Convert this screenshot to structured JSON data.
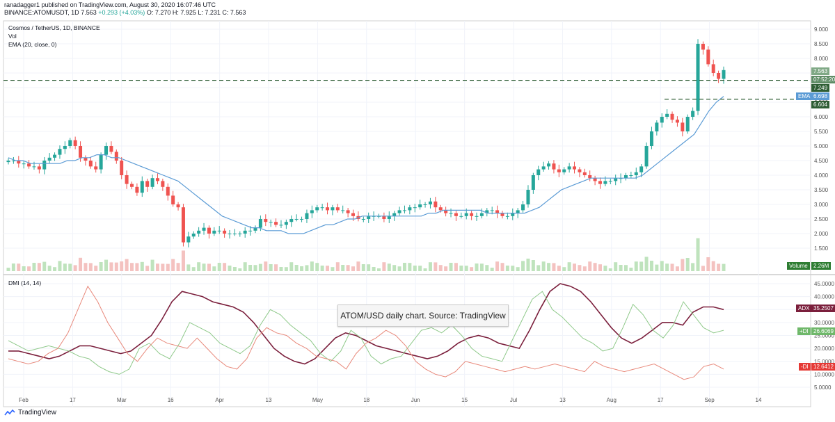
{
  "header": {
    "publish_line": "ranadagger1 published on TradingView.com, August 30, 2020 16:07:46 UTC",
    "symbol": "BINANCE:ATOMUSDT, 1D",
    "last": "7.563",
    "change": "+0.293 (+4.03%)",
    "ohlc": "O: 7.270  H: 7.925  L: 7.231  C: 7.563"
  },
  "legend": {
    "title": "Cosmos / TetherUS, 1D, BINANCE",
    "vol": "Vol",
    "ema": "EMA (20, close, 0)",
    "dmi": "DMI (14, 14)"
  },
  "price_tags": {
    "last": "7.563",
    "countdown": "07:52:20",
    "level_a": "7.249",
    "ema_label": "EMA",
    "ema_value": "6.698",
    "level_b": "6.604",
    "volume_label": "Volume",
    "volume_value": "2.26M"
  },
  "dmi_tags": {
    "adx_label": "ADX",
    "adx_value": "35.2507",
    "pdi_label": "+DI",
    "pdi_value": "26.6069",
    "mdi_label": "-DI",
    "mdi_value": "12.6412"
  },
  "caption": "ATOM/USD daily chart. Source: TradingView",
  "brand": "TradingView",
  "colors": {
    "up": "#26a69a",
    "down": "#ef5350",
    "ema": "#5b9bd5",
    "adx": "#7b1f3c",
    "plus_di": "#8fc98a",
    "minus_di": "#e8887a",
    "level": "#2e5d34"
  },
  "chart_data": [
    {
      "type": "candlestick",
      "title": "Cosmos / TetherUS, 1D, BINANCE",
      "y_ticks": [
        "9.000",
        "8.500",
        "8.000",
        "7.500",
        "7.000",
        "6.500",
        "6.000",
        "5.500",
        "5.000",
        "4.500",
        "4.000",
        "3.500",
        "3.000",
        "2.500",
        "2.000",
        "1.500"
      ],
      "x_ticks": [
        "Feb",
        "17",
        "Mar",
        "16",
        "Apr",
        "13",
        "May",
        "18",
        "Jun",
        "15",
        "Jul",
        "13",
        "Aug",
        "17",
        "Sep",
        "14"
      ],
      "ylim": [
        1.0,
        9.2
      ],
      "close_approx": [
        4.5,
        4.5,
        4.4,
        4.4,
        4.3,
        4.3,
        4.2,
        4.5,
        4.6,
        4.7,
        4.9,
        5.0,
        5.2,
        5.0,
        4.6,
        4.5,
        4.3,
        4.2,
        4.7,
        5.0,
        4.8,
        4.5,
        4.0,
        3.7,
        3.6,
        3.4,
        3.8,
        3.6,
        3.9,
        3.8,
        3.6,
        3.3,
        3.0,
        2.9,
        1.7,
        1.9,
        2.0,
        2.1,
        2.2,
        2.0,
        2.1,
        2.1,
        2.0,
        2.0,
        2.0,
        2.0,
        2.1,
        2.1,
        2.2,
        2.5,
        2.4,
        2.4,
        2.3,
        2.3,
        2.4,
        2.5,
        2.5,
        2.5,
        2.7,
        2.8,
        2.9,
        2.9,
        2.8,
        2.9,
        2.8,
        2.8,
        2.7,
        2.6,
        2.5,
        2.5,
        2.6,
        2.6,
        2.6,
        2.5,
        2.6,
        2.7,
        2.8,
        2.8,
        2.9,
        2.9,
        3.0,
        3.0,
        3.1,
        2.9,
        2.8,
        2.7,
        2.7,
        2.6,
        2.6,
        2.7,
        2.6,
        2.6,
        2.7,
        2.8,
        2.8,
        2.7,
        2.6,
        2.6,
        2.7,
        2.8,
        3.0,
        3.5,
        4.0,
        4.2,
        4.3,
        4.4,
        4.2,
        4.1,
        4.2,
        4.3,
        4.2,
        4.1,
        4.0,
        3.9,
        3.8,
        3.7,
        3.8,
        3.8,
        3.9,
        3.9,
        4.0,
        4.0,
        4.1,
        4.3,
        5.0,
        5.5,
        5.8,
        6.0,
        6.1,
        5.9,
        5.8,
        5.5,
        6.0,
        6.2,
        8.5,
        8.3,
        7.8,
        7.5,
        7.3,
        7.6
      ],
      "ema20_approx": [
        4.6,
        4.5,
        4.5,
        4.4,
        4.4,
        4.4,
        4.4,
        4.4,
        4.5,
        4.5,
        4.6,
        4.6,
        4.7,
        4.7,
        4.6,
        4.6,
        4.5,
        4.4,
        4.3,
        4.2,
        4.1,
        4.0,
        3.9,
        3.8,
        3.6,
        3.4,
        3.2,
        3.0,
        2.8,
        2.6,
        2.5,
        2.4,
        2.3,
        2.2,
        2.2,
        2.1,
        2.1,
        2.1,
        2.0,
        2.0,
        2.0,
        2.1,
        2.2,
        2.3,
        2.3,
        2.4,
        2.5,
        2.5,
        2.6,
        2.6,
        2.6,
        2.6,
        2.6,
        2.6,
        2.6,
        2.6,
        2.6,
        2.7,
        2.7,
        2.8,
        2.8,
        2.8,
        2.8,
        2.8,
        2.8,
        2.7,
        2.7,
        2.7,
        2.7,
        2.7,
        2.7,
        2.8,
        2.9,
        3.1,
        3.3,
        3.5,
        3.6,
        3.7,
        3.8,
        3.9,
        3.9,
        3.9,
        3.9,
        3.9,
        3.9,
        3.9,
        4.0,
        4.2,
        4.4,
        4.6,
        4.8,
        5.0,
        5.2,
        5.4,
        5.8,
        6.2,
        6.5,
        6.7
      ]
    },
    {
      "type": "line",
      "title": "DMI (14, 14)",
      "y_ticks": [
        "45.0000",
        "40.0000",
        "35.0000",
        "30.0000",
        "25.0000",
        "20.0000",
        "15.0000",
        "10.0000",
        "5.0000"
      ],
      "ylim": [
        2,
        47
      ],
      "series": [
        {
          "name": "ADX",
          "values": [
            19,
            19,
            18,
            17,
            16,
            17,
            19,
            21,
            21,
            20,
            19,
            18,
            19,
            22,
            25,
            31,
            38,
            42,
            41,
            40,
            38,
            37,
            36,
            34,
            30,
            25,
            20,
            17,
            15,
            14,
            16,
            20,
            24,
            26,
            25,
            23,
            21,
            20,
            19,
            18,
            17,
            16,
            17,
            19,
            22,
            24,
            25,
            24,
            22,
            21,
            20,
            27,
            35,
            42,
            45,
            44,
            42,
            38,
            33,
            28,
            24,
            22,
            24,
            27,
            30,
            30,
            29,
            34,
            36,
            36,
            35
          ]
        },
        {
          "name": "+DI",
          "values": [
            23,
            21,
            19,
            20,
            21,
            20,
            19,
            17,
            16,
            13,
            11,
            10,
            12,
            20,
            22,
            18,
            16,
            22,
            30,
            28,
            26,
            22,
            20,
            18,
            21,
            29,
            35,
            33,
            29,
            26,
            23,
            18,
            15,
            19,
            27,
            24,
            17,
            14,
            16,
            17,
            22,
            27,
            28,
            26,
            29,
            25,
            20,
            17,
            16,
            15,
            23,
            31,
            39,
            42,
            35,
            32,
            28,
            24,
            22,
            19,
            20,
            28,
            37,
            33,
            27,
            24,
            29,
            38,
            33,
            28,
            26,
            27
          ]
        },
        {
          "name": "-DI",
          "values": [
            16,
            15,
            14,
            15,
            18,
            20,
            26,
            35,
            44,
            38,
            30,
            24,
            18,
            15,
            20,
            24,
            22,
            21,
            20,
            24,
            20,
            16,
            13,
            12,
            16,
            24,
            28,
            26,
            25,
            22,
            20,
            17,
            16,
            15,
            12,
            18,
            22,
            24,
            27,
            25,
            21,
            15,
            12,
            10,
            9,
            11,
            15,
            14,
            13,
            12,
            11,
            12,
            13,
            12,
            13,
            14,
            13,
            12,
            11,
            15,
            13,
            12,
            11,
            12,
            13,
            14,
            12,
            10,
            8,
            9,
            13,
            14,
            12
          ]
        }
      ]
    }
  ]
}
